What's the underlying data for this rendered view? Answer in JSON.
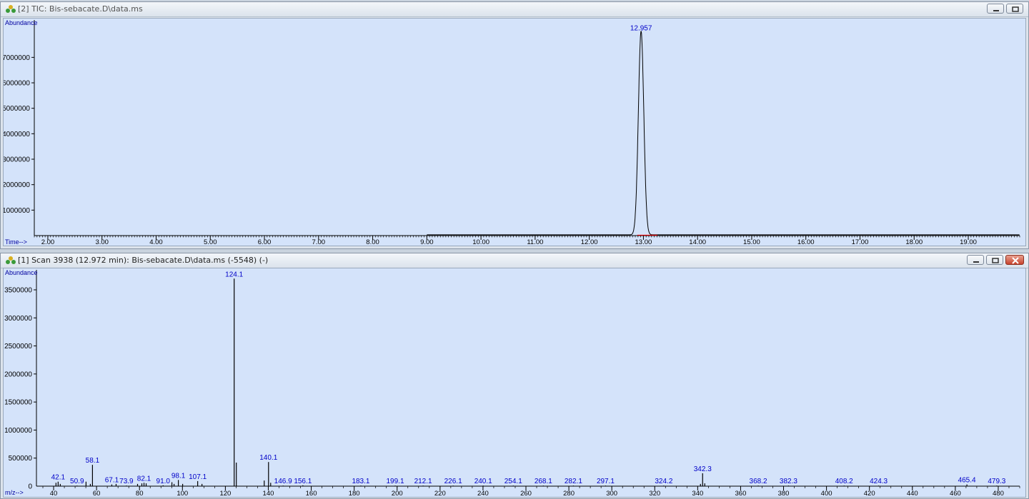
{
  "tic_window": {
    "title": "[2] TIC: Bis-sebacate.D\\data.ms",
    "icon": "agilent-chem-icon",
    "buttons": [
      "minimize-icon",
      "restore-icon"
    ]
  },
  "spectrum_window": {
    "title": "[1] Scan 3938 (12.972 min): Bis-sebacate.D\\data.ms (-5548) (-)",
    "icon": "agilent-chem-icon",
    "buttons": [
      "minimize-icon",
      "restore-icon",
      "close-icon"
    ]
  },
  "chart_data": [
    {
      "type": "line",
      "ylabel": "Abundance",
      "xlabel": "Time-->",
      "xlim": [
        1.75,
        19.95
      ],
      "ylim": [
        0,
        8300000
      ],
      "y_ticks": [
        "1000000",
        "2000000",
        "3000000",
        "4000000",
        "5000000",
        "6000000",
        "7000000"
      ],
      "x_ticks": [
        "2.00",
        "3.00",
        "4.00",
        "5.00",
        "6.00",
        "7.00",
        "8.00",
        "9.00",
        "10.00",
        "11.00",
        "12.00",
        "13.00",
        "14.00",
        "15.00",
        "16.00",
        "17.00",
        "18.00",
        "19.00"
      ],
      "peak": {
        "x": 12.957,
        "y": 8000000,
        "width": 0.05,
        "label": "12.957"
      },
      "baseline": 30000,
      "line_color": "#000000",
      "baseline_marker_color": "#ff0000"
    },
    {
      "type": "bar",
      "ylabel": "Abundance",
      "xlabel": "m/z-->",
      "xlim": [
        32,
        490
      ],
      "ylim": [
        0,
        3780000
      ],
      "y_ticks": [
        "500000",
        "1000000",
        "1500000",
        "2000000",
        "2500000",
        "3000000",
        "3500000"
      ],
      "x_ticks": [
        "40",
        "60",
        "80",
        "100",
        "120",
        "140",
        "160",
        "180",
        "200",
        "220",
        "240",
        "260",
        "280",
        "300",
        "320",
        "340",
        "360",
        "380",
        "400",
        "420",
        "440",
        "460",
        "480"
      ],
      "bars": [
        {
          "mz": 41.1,
          "value": 60000,
          "label": ""
        },
        {
          "mz": 42.1,
          "value": 80000,
          "label": "42.1"
        },
        {
          "mz": 43.1,
          "value": 40000,
          "label": ""
        },
        {
          "mz": 50.9,
          "value": 10000,
          "label": "50.9"
        },
        {
          "mz": 55.1,
          "value": 80000,
          "label": ""
        },
        {
          "mz": 57.1,
          "value": 40000,
          "label": ""
        },
        {
          "mz": 58.1,
          "value": 380000,
          "label": "58.1"
        },
        {
          "mz": 67.1,
          "value": 30000,
          "label": "67.1"
        },
        {
          "mz": 69.1,
          "value": 40000,
          "label": ""
        },
        {
          "mz": 73.9,
          "value": 10000,
          "label": "73.9"
        },
        {
          "mz": 79.1,
          "value": 40000,
          "label": ""
        },
        {
          "mz": 81.1,
          "value": 50000,
          "label": ""
        },
        {
          "mz": 82.1,
          "value": 60000,
          "label": "82.1"
        },
        {
          "mz": 83.1,
          "value": 50000,
          "label": ""
        },
        {
          "mz": 91.0,
          "value": 15000,
          "label": "91.0"
        },
        {
          "mz": 95.1,
          "value": 70000,
          "label": ""
        },
        {
          "mz": 96.1,
          "value": 40000,
          "label": ""
        },
        {
          "mz": 98.1,
          "value": 110000,
          "label": "98.1"
        },
        {
          "mz": 100.1,
          "value": 40000,
          "label": ""
        },
        {
          "mz": 107.1,
          "value": 90000,
          "label": "107.1"
        },
        {
          "mz": 109.1,
          "value": 40000,
          "label": ""
        },
        {
          "mz": 124.1,
          "value": 3700000,
          "label": "124.1"
        },
        {
          "mz": 125.1,
          "value": 420000,
          "label": ""
        },
        {
          "mz": 138.1,
          "value": 100000,
          "label": ""
        },
        {
          "mz": 140.1,
          "value": 430000,
          "label": "140.1"
        },
        {
          "mz": 141.1,
          "value": 60000,
          "label": ""
        },
        {
          "mz": 146.9,
          "value": 10000,
          "label": "146.9"
        },
        {
          "mz": 156.1,
          "value": 15000,
          "label": "156.1"
        },
        {
          "mz": 183.1,
          "value": 10000,
          "label": "183.1"
        },
        {
          "mz": 199.1,
          "value": 10000,
          "label": "199.1"
        },
        {
          "mz": 212.1,
          "value": 10000,
          "label": "212.1"
        },
        {
          "mz": 226.1,
          "value": 10000,
          "label": "226.1"
        },
        {
          "mz": 240.1,
          "value": 10000,
          "label": "240.1"
        },
        {
          "mz": 254.1,
          "value": 10000,
          "label": "254.1"
        },
        {
          "mz": 268.1,
          "value": 10000,
          "label": "268.1"
        },
        {
          "mz": 282.1,
          "value": 10000,
          "label": "282.1"
        },
        {
          "mz": 297.1,
          "value": 10000,
          "label": "297.1"
        },
        {
          "mz": 324.2,
          "value": 10000,
          "label": "324.2"
        },
        {
          "mz": 341.3,
          "value": 40000,
          "label": ""
        },
        {
          "mz": 342.3,
          "value": 230000,
          "label": "342.3"
        },
        {
          "mz": 343.3,
          "value": 50000,
          "label": ""
        },
        {
          "mz": 368.2,
          "value": 10000,
          "label": "368.2"
        },
        {
          "mz": 382.3,
          "value": 10000,
          "label": "382.3"
        },
        {
          "mz": 408.2,
          "value": 10000,
          "label": "408.2"
        },
        {
          "mz": 424.3,
          "value": 10000,
          "label": "424.3"
        },
        {
          "mz": 465.4,
          "value": 30000,
          "label": "465.4"
        },
        {
          "mz": 479.3,
          "value": 10000,
          "label": "479.3"
        }
      ],
      "bar_color": "#000000"
    }
  ]
}
